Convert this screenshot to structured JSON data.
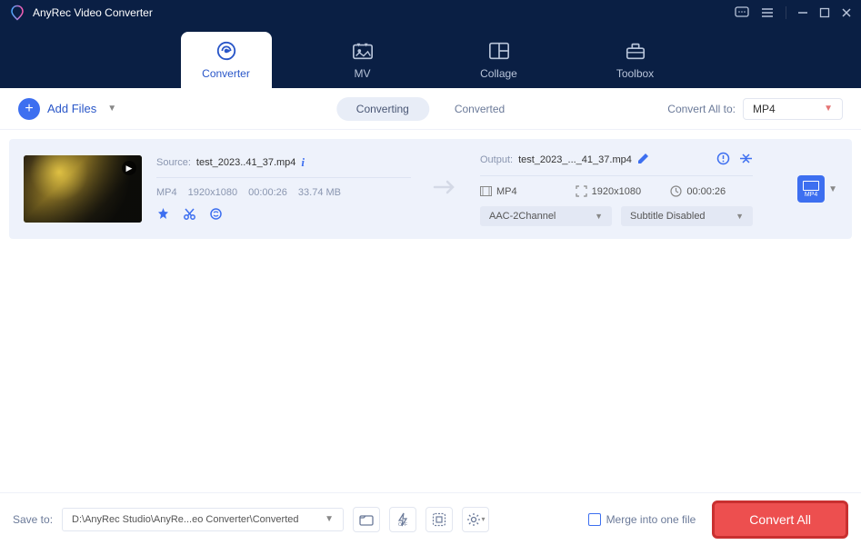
{
  "app": {
    "title": "AnyRec Video Converter"
  },
  "nav": {
    "tabs": [
      {
        "label": "Converter"
      },
      {
        "label": "MV"
      },
      {
        "label": "Collage"
      },
      {
        "label": "Toolbox"
      }
    ]
  },
  "subbar": {
    "addFiles": "Add Files",
    "tabs": {
      "converting": "Converting",
      "converted": "Converted"
    },
    "convertAllTo": "Convert All to:",
    "targetFormat": "MP4"
  },
  "file": {
    "source": {
      "label": "Source:",
      "name": "test_2023..41_37.mp4",
      "format": "MP4",
      "resolution": "1920x1080",
      "duration": "00:00:26",
      "size": "33.74 MB"
    },
    "output": {
      "label": "Output:",
      "name": "test_2023_..._41_37.mp4",
      "format": "MP4",
      "resolution": "1920x1080",
      "duration": "00:00:26",
      "audio": "AAC-2Channel",
      "subtitle": "Subtitle Disabled",
      "formatBadge": "MP4"
    }
  },
  "bottom": {
    "saveTo": "Save to:",
    "path": "D:\\AnyRec Studio\\AnyRe...eo Converter\\Converted",
    "merge": "Merge into one file",
    "convertAll": "Convert All"
  }
}
